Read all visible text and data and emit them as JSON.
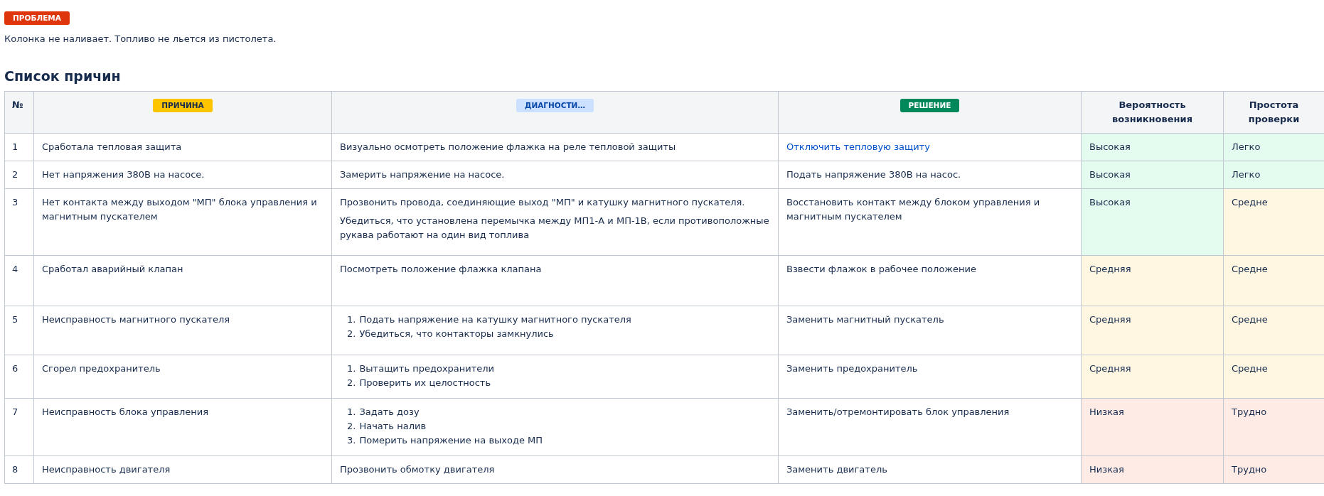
{
  "problem_badge": "ПРОБЛЕМА",
  "problem_text": "Колонка не наливает. Топливо не льется из пистолета.",
  "heading": "Список причин",
  "table": {
    "columns": [
      {
        "kind": "text",
        "label": "№"
      },
      {
        "kind": "badge",
        "label": "ПРИЧИНА",
        "color": "#ffc400"
      },
      {
        "kind": "badge",
        "label": "ДИАГНОСТИ…",
        "color": "#cce0ff"
      },
      {
        "kind": "badge",
        "label": "РЕШЕНИЕ",
        "color": "#00875a"
      },
      {
        "kind": "text",
        "label": "Вероятность возникновения"
      },
      {
        "kind": "text",
        "label": "Простота проверки"
      }
    ],
    "rows": [
      {
        "num": "1",
        "cause": "Сработала тепловая защита",
        "diagnostics": {
          "kind": "paragraphs",
          "items": [
            "Визуально осмотреть положение флажка на реле тепловой защиты"
          ]
        },
        "solution": {
          "text": "Отключить тепловую защиту",
          "link": true
        },
        "probability": {
          "text": "Высокая",
          "color": "#e3fcef"
        },
        "ease": {
          "text": "Легко",
          "color": "#e3fcef"
        }
      },
      {
        "num": "2",
        "cause": "Нет напряжения 380В на насосе.",
        "diagnostics": {
          "kind": "paragraphs",
          "items": [
            "Замерить напряжение на насосе."
          ]
        },
        "solution": {
          "text": "Подать напряжение 380В на насос.",
          "link": false
        },
        "probability": {
          "text": "Высокая",
          "color": "#e3fcef"
        },
        "ease": {
          "text": "Легко",
          "color": "#e3fcef"
        }
      },
      {
        "num": "3",
        "cause": "Нет контакта между выходом \"МП\" блока управления и магнитным пускателем",
        "diagnostics": {
          "kind": "paragraphs",
          "items": [
            "Прозвонить провода, соединяющие выход \"МП\" и катушку магнитного пускателя.",
            "Убедиться, что установлена перемычка между МП1-А и МП-1В, если противоположные рукава работают на один вид топлива"
          ]
        },
        "solution": {
          "text": "Восстановить контакт между блоком управления и магнитным пускателем",
          "link": false
        },
        "probability": {
          "text": "Высокая",
          "color": "#e3fcef"
        },
        "ease": {
          "text": "Средне",
          "color": "#fff7e1"
        }
      },
      {
        "num": "4",
        "cause": "Сработал аварийный клапан",
        "diagnostics": {
          "kind": "paragraphs",
          "items": [
            "Посмотреть положение флажка клапана"
          ]
        },
        "solution": {
          "text": "Взвести флажок в рабочее положение",
          "link": false
        },
        "probability": {
          "text": "Средняя",
          "color": "#fff7e1"
        },
        "ease": {
          "text": "Средне",
          "color": "#fff7e1"
        }
      },
      {
        "num": "5",
        "cause": "Неисправность магнитного пускателя",
        "diagnostics": {
          "kind": "list",
          "items": [
            {
              "marker": "1.",
              "text": "Подать напряжение на катушку магнитного пускателя"
            },
            {
              "marker": "2.",
              "text": "Убедиться, что контакторы замкнулись"
            }
          ]
        },
        "solution": {
          "text": "Заменить магнитный пускатель",
          "link": false
        },
        "probability": {
          "text": "Средняя",
          "color": "#fff7e1"
        },
        "ease": {
          "text": "Средне",
          "color": "#fff7e1"
        }
      },
      {
        "num": "6",
        "cause": "Сгорел предохранитель",
        "diagnostics": {
          "kind": "list",
          "items": [
            {
              "marker": "1.",
              "text": "Вытащить предохранители"
            },
            {
              "marker": "2.",
              "text": "Проверить их целостность"
            }
          ]
        },
        "solution": {
          "text": "Заменить предохранитель",
          "link": false
        },
        "probability": {
          "text": "Средняя",
          "color": "#fff7e1"
        },
        "ease": {
          "text": "Средне",
          "color": "#fff7e1"
        }
      },
      {
        "num": "7",
        "cause": "Неисправность блока управления",
        "diagnostics": {
          "kind": "list",
          "items": [
            {
              "marker": "1.",
              "text": "Задать дозу"
            },
            {
              "marker": "2.",
              "text": "Начать налив"
            },
            {
              "marker": "3.",
              "text": "Померить напряжение на выходе МП"
            }
          ]
        },
        "solution": {
          "text": "Заменить/отремонтировать блок управления",
          "link": false
        },
        "probability": {
          "text": "Низкая",
          "color": "#ffebe6"
        },
        "ease": {
          "text": "Трудно",
          "color": "#ffebe6"
        }
      },
      {
        "num": "8",
        "cause": "Неисправность двигателя",
        "diagnostics": {
          "kind": "paragraphs",
          "items": [
            "Прозвонить обмотку двигателя"
          ]
        },
        "solution": {
          "text": "Заменить двигатель",
          "link": false
        },
        "probability": {
          "text": "Низкая",
          "color": "#ffebe6"
        },
        "ease": {
          "text": "Трудно",
          "color": "#ffebe6"
        }
      }
    ]
  }
}
